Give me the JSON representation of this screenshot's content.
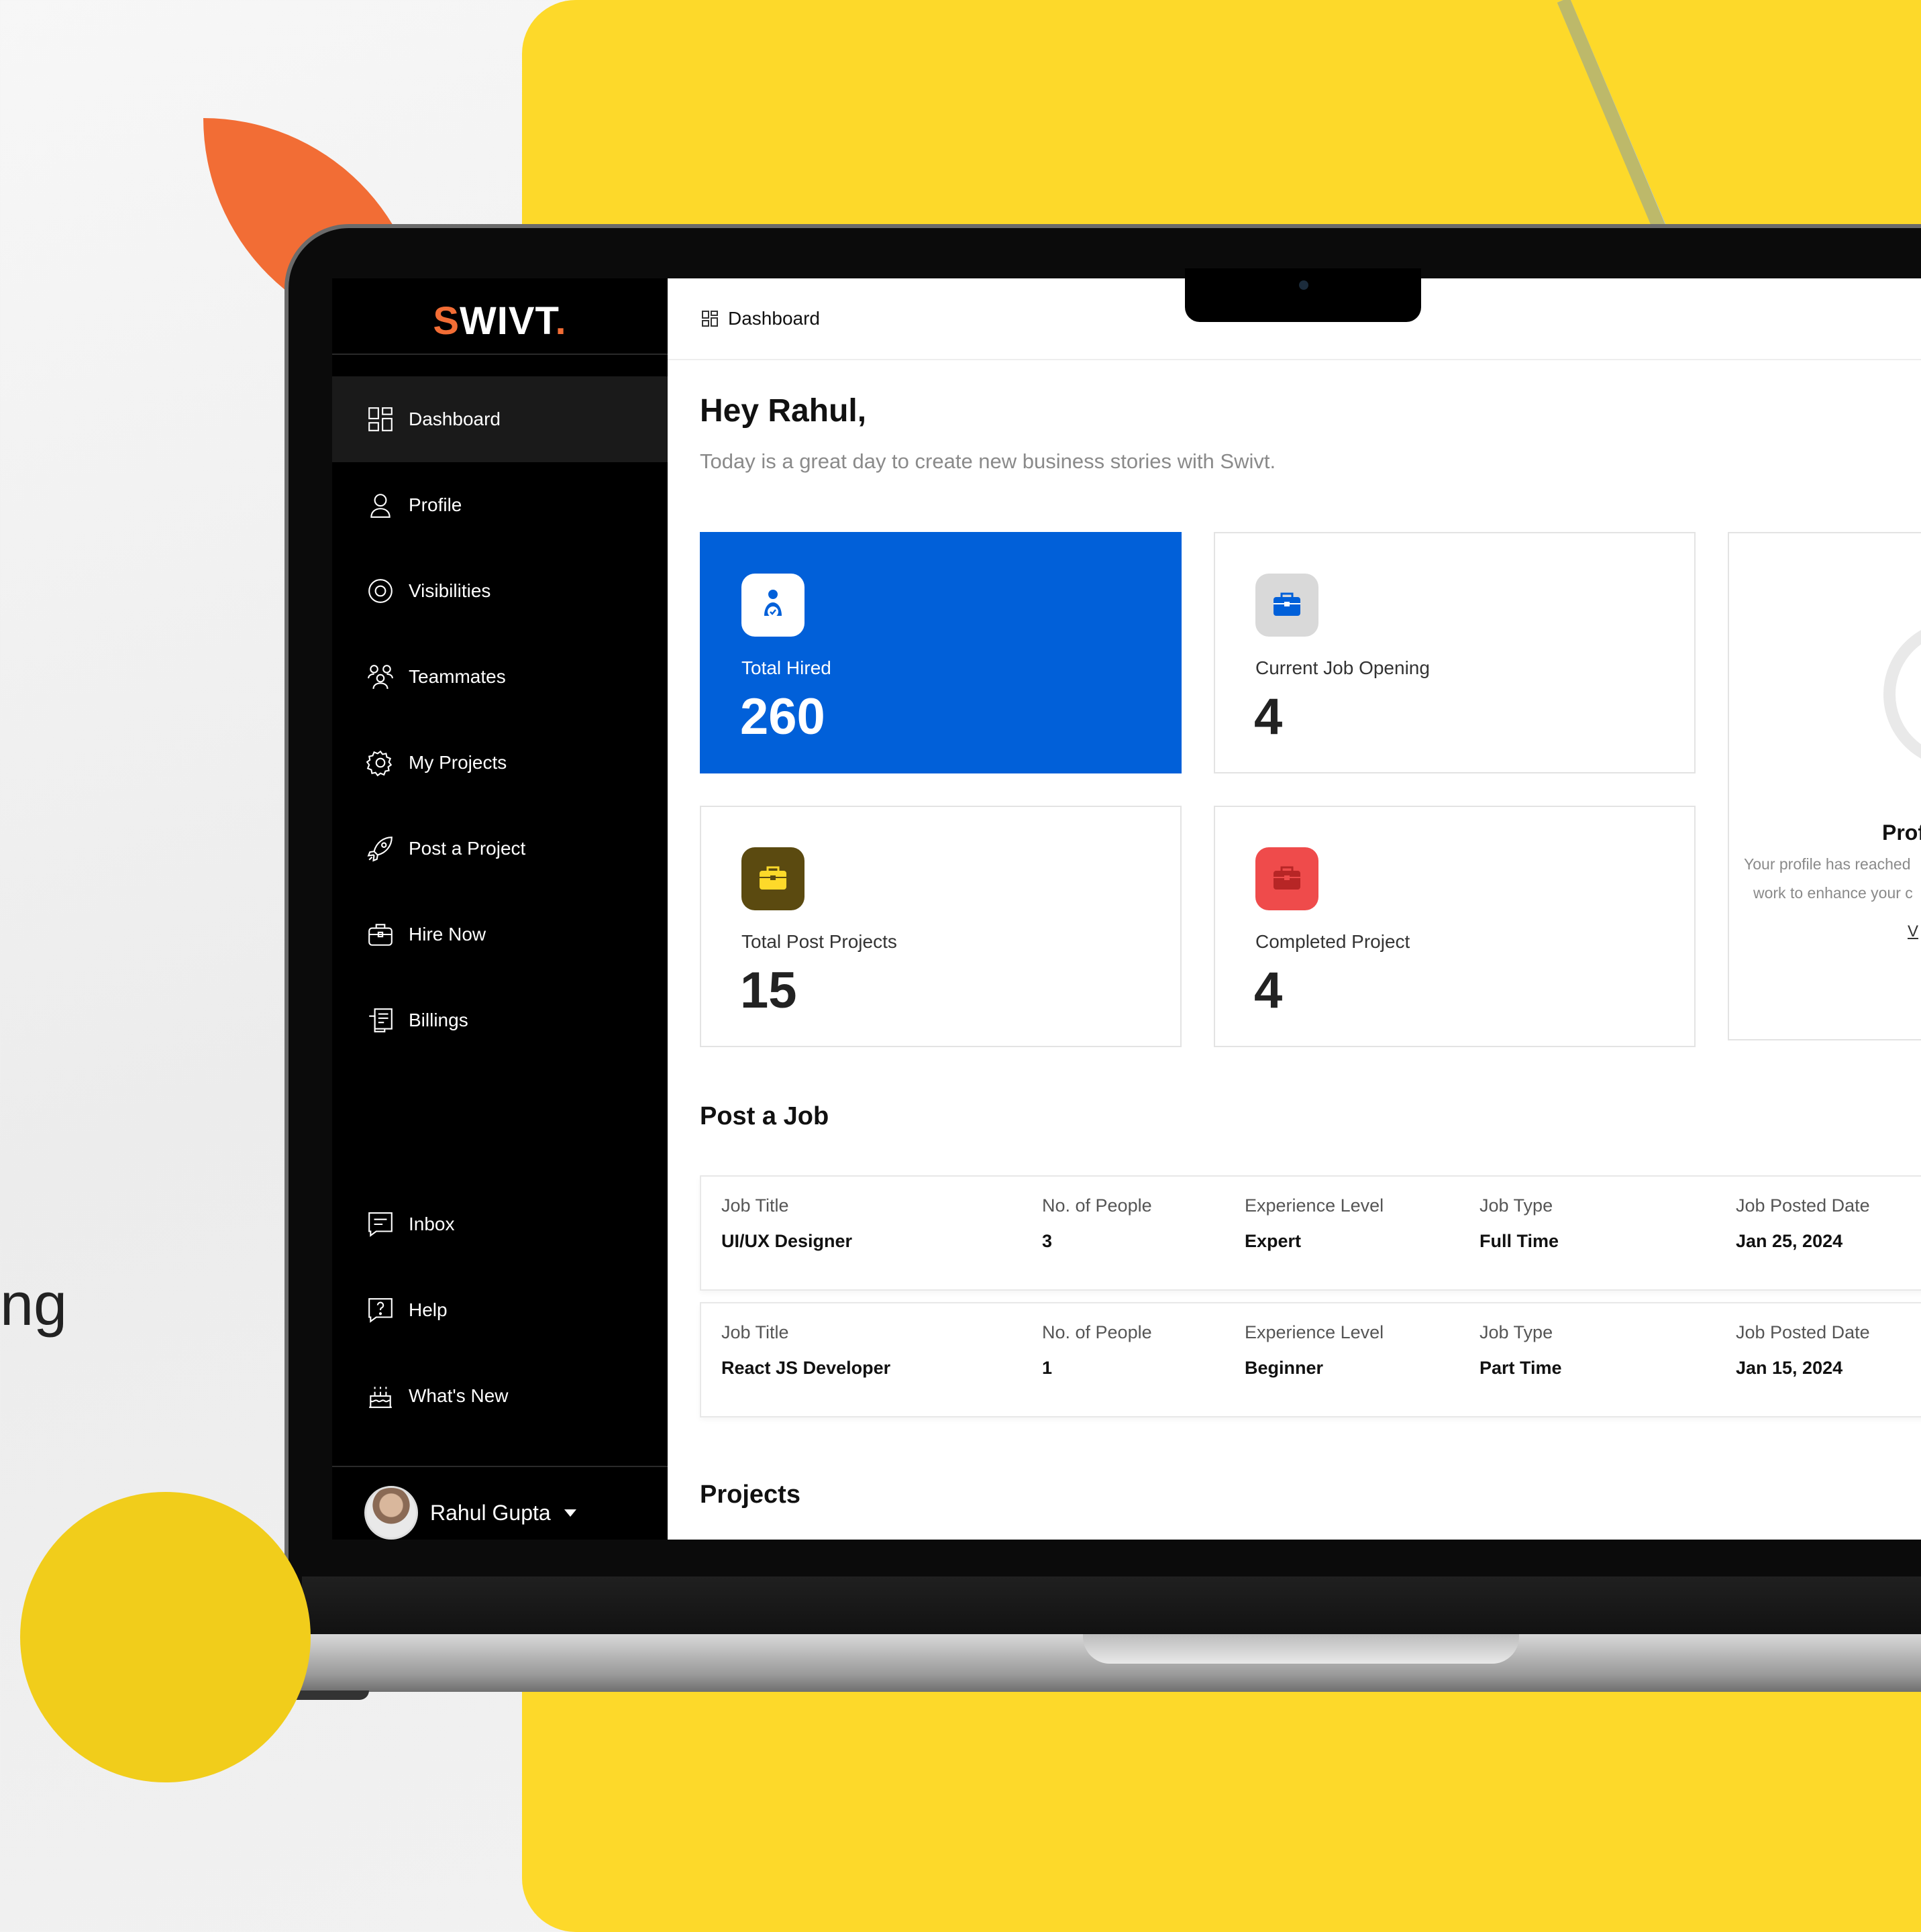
{
  "background": {
    "partial_text": "ng",
    "colors": {
      "yellow": "#FDD92A",
      "orange": "#F26D35",
      "sidebar": "#000000",
      "accent_blue": "#0160D9"
    }
  },
  "app": {
    "logo": {
      "first": "S",
      "rest": "WIVT",
      "dot": "."
    }
  },
  "sidebar": {
    "items": [
      {
        "label": "Dashboard",
        "icon": "grid-icon"
      },
      {
        "label": "Profile",
        "icon": "user-icon"
      },
      {
        "label": "Visibilities",
        "icon": "eye-icon"
      },
      {
        "label": "Teammates",
        "icon": "team-icon"
      },
      {
        "label": "My Projects",
        "icon": "gear-brain-icon"
      },
      {
        "label": "Post a Project",
        "icon": "rocket-icon"
      },
      {
        "label": "Hire Now",
        "icon": "briefcase-icon"
      },
      {
        "label": "Billings",
        "icon": "billing-icon"
      }
    ],
    "bottom_items": [
      {
        "label": "Inbox",
        "icon": "message-icon"
      },
      {
        "label": "Help",
        "icon": "help-icon"
      },
      {
        "label": "What's New",
        "icon": "cake-icon"
      }
    ],
    "user": {
      "name": "Rahul Gupta"
    }
  },
  "topbar": {
    "breadcrumb": "Dashboard"
  },
  "main": {
    "greeting": "Hey Rahul,",
    "subtitle": "Today is a great day to create new business stories with Swivt.",
    "stats": [
      {
        "label": "Total Hired",
        "value": "260",
        "icon": "hired-user-icon",
        "icon_bg": "#FFFFFF"
      },
      {
        "label": "Current Job Opening",
        "value": "4",
        "icon": "briefcase-icon",
        "icon_bg": "#D9D9D9"
      },
      {
        "label": "Total Post Projects",
        "value": "15",
        "icon": "briefcase-icon",
        "icon_bg": "#5B4A10"
      },
      {
        "label": "Completed Project",
        "value": "4",
        "icon": "briefcase-icon",
        "icon_bg": "#EF4B4B"
      }
    ],
    "profile_card": {
      "title": "Prof",
      "desc_line1": "Your profile has reached",
      "desc_line2": "work to enhance your c",
      "link": "V"
    },
    "post_job": {
      "title": "Post a Job",
      "labels": [
        "Job Title",
        "No. of People",
        "Experience Level",
        "Job Type",
        "Job Posted Date"
      ],
      "rows": [
        {
          "title": "UI/UX Designer",
          "people": "3",
          "level": "Expert",
          "type": "Full Time",
          "date": "Jan 25, 2024"
        },
        {
          "title": "React JS Developer",
          "people": "1",
          "level": "Beginner",
          "type": "Part Time",
          "date": "Jan 15, 2024"
        }
      ]
    },
    "projects_title": "Projects"
  }
}
